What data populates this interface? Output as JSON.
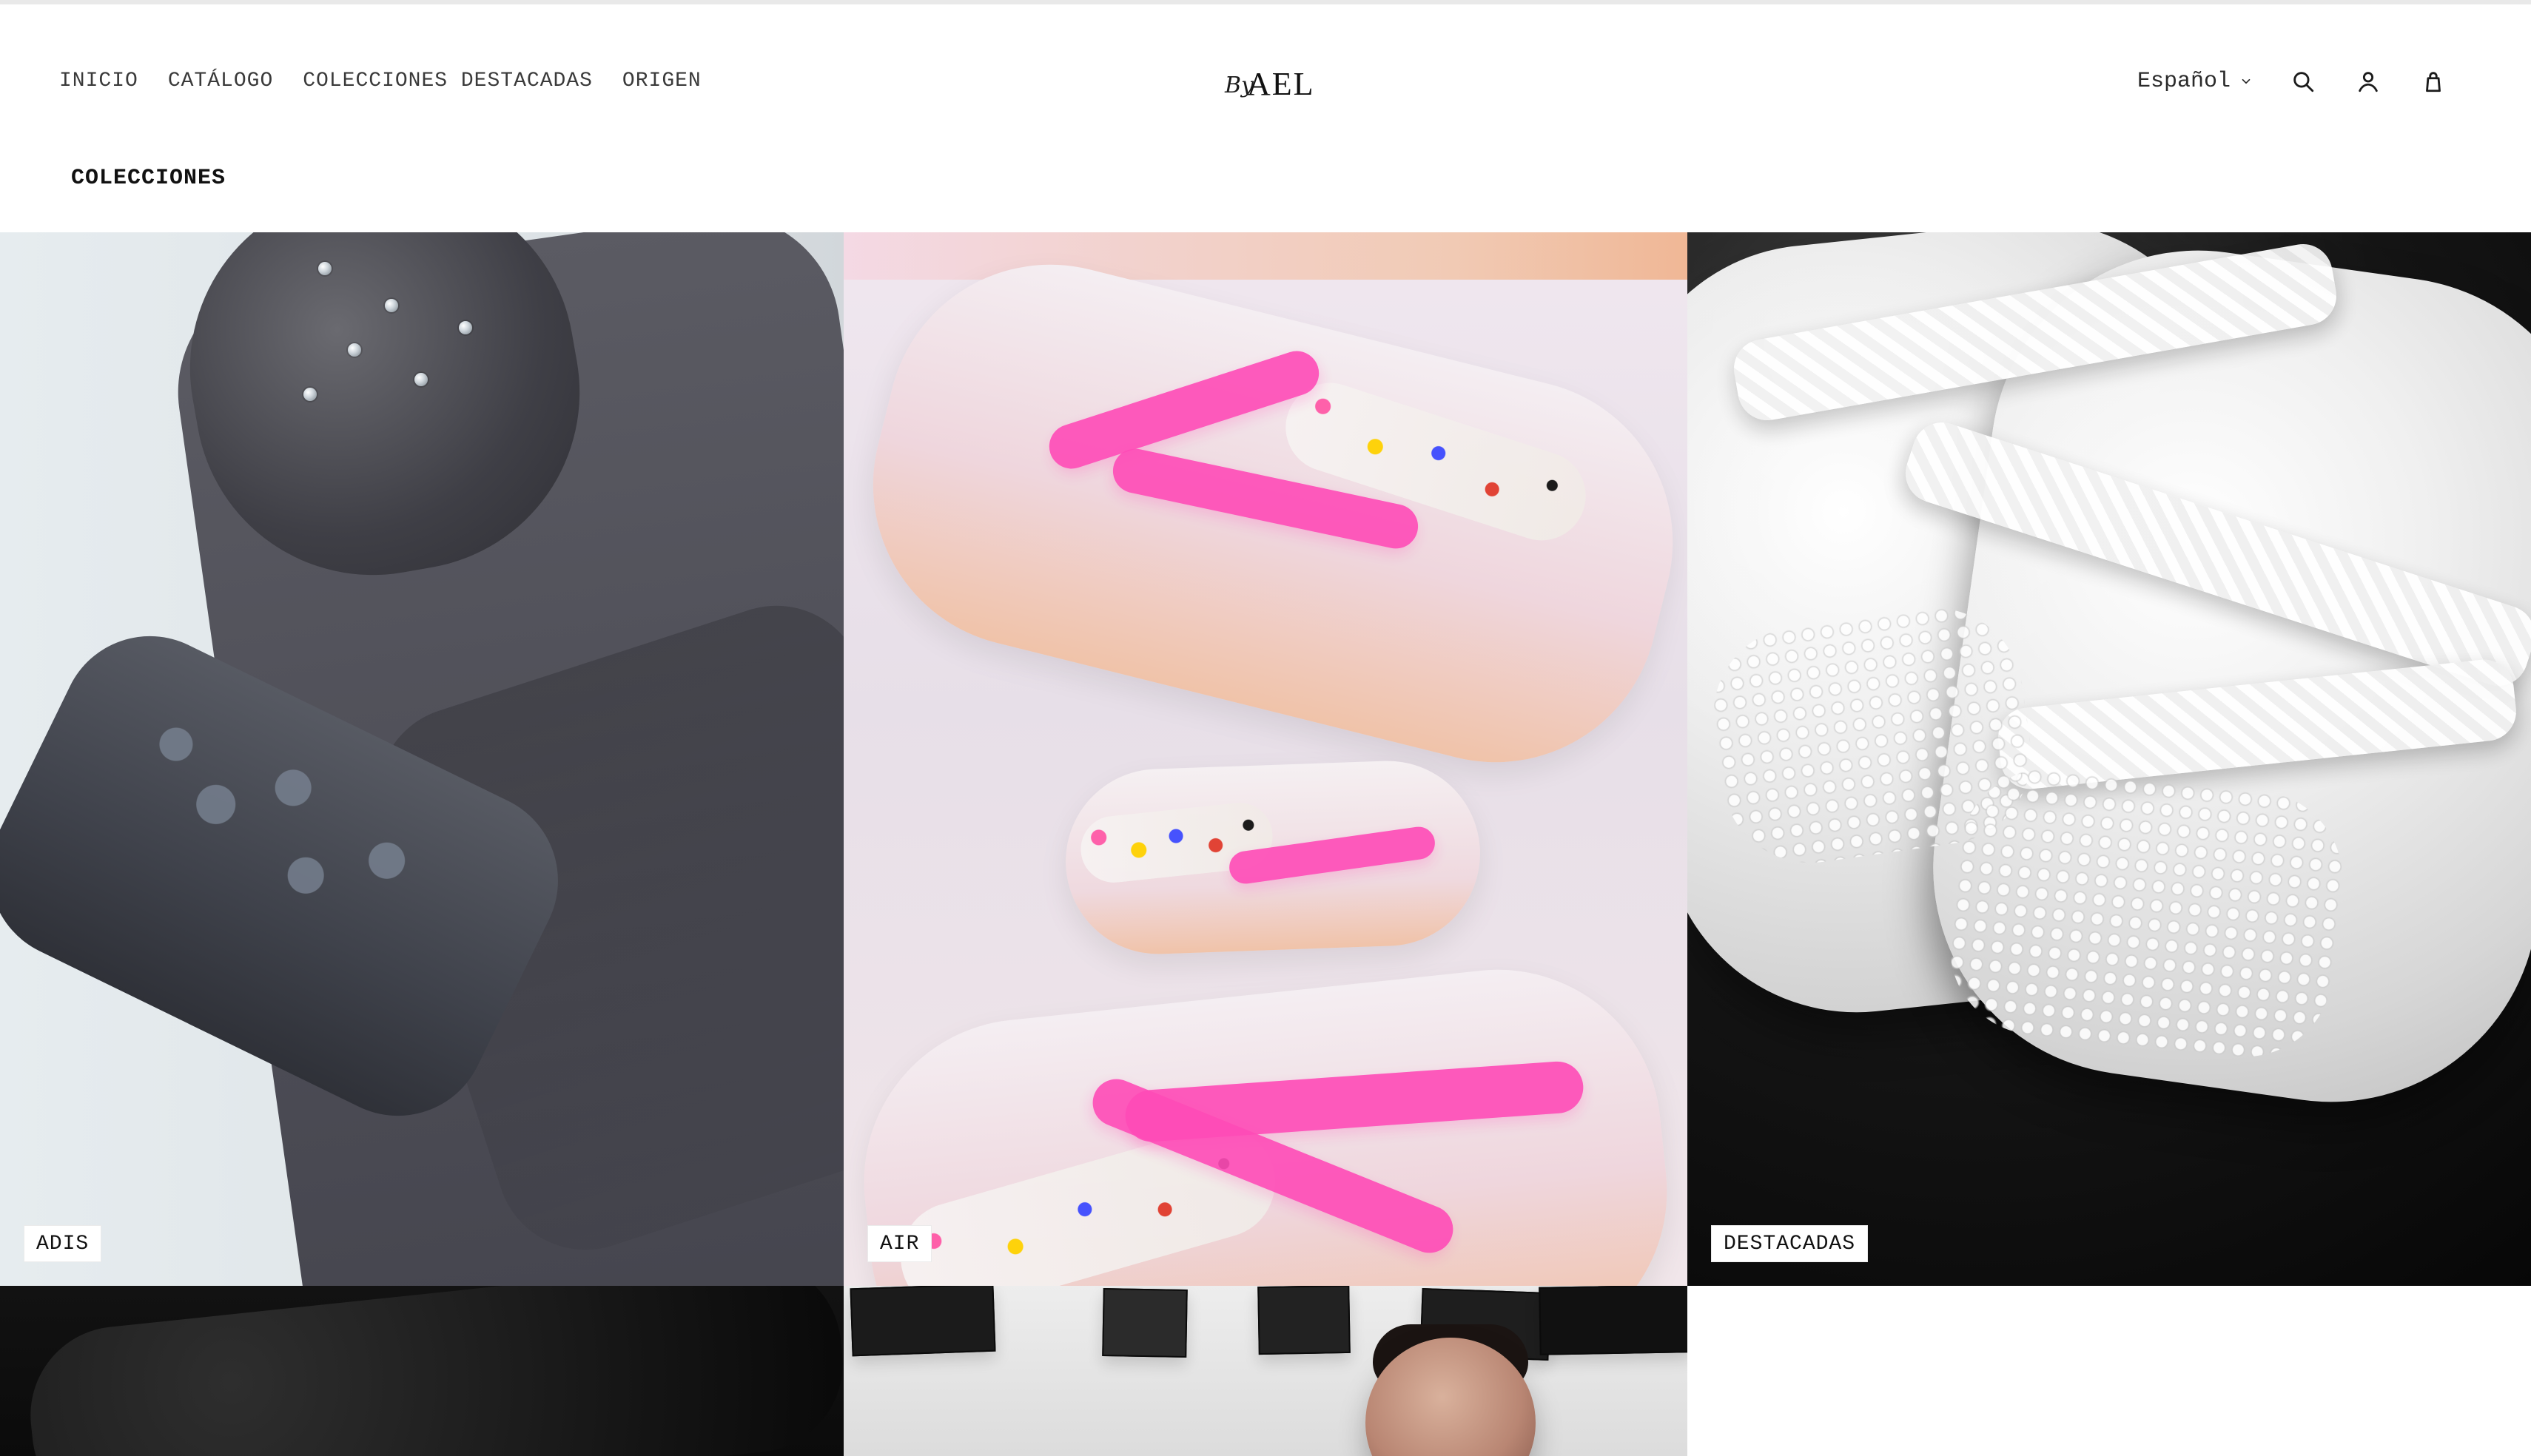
{
  "header": {
    "nav": [
      {
        "label": "INICIO"
      },
      {
        "label": "CATÁLOGO"
      },
      {
        "label": "COLECCIONES DESTACADAS"
      },
      {
        "label": "ORIGEN"
      }
    ],
    "logo": {
      "text_small": "By",
      "text_main": "AEL"
    },
    "language": {
      "label": "Español"
    },
    "icons": {
      "search": "search-icon",
      "account": "user-icon",
      "cart": "cart-icon",
      "chevron": "chevron-down-icon"
    }
  },
  "page": {
    "section_title": "COLECCIONES"
  },
  "collections": [
    {
      "label": "ADIS"
    },
    {
      "label": "AIR"
    },
    {
      "label": "DESTACADAS"
    }
  ],
  "colors": {
    "text_primary": "#111111",
    "text_secondary": "#3a3a3a",
    "background": "#ffffff",
    "divider": "#e9e9e9"
  }
}
